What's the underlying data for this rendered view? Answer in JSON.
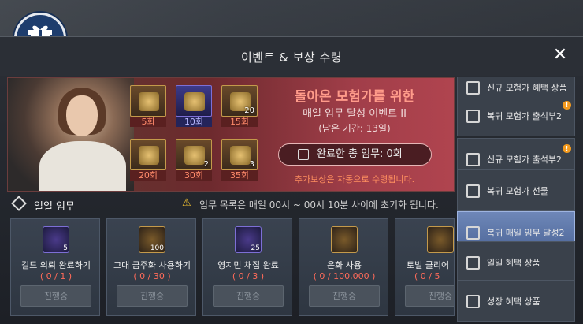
{
  "header": {
    "title": "이벤트 & 보상 수령",
    "close_glyph": "✕"
  },
  "banner": {
    "title": "돌아온 모험가를 위한",
    "subtitle": "매일 임무 달성 이벤트 II",
    "period": "(남은 기간: 13일)",
    "progress_text": "완료한 총 임무: 0회",
    "note": "추가보상은 자동으로 수령됩니다.",
    "rewards": [
      {
        "label": "5회",
        "count": "",
        "tier": "gold"
      },
      {
        "label": "10회",
        "count": "",
        "tier": "blue"
      },
      {
        "label": "15회",
        "count": "20",
        "tier": "gold"
      },
      {
        "label": "20회",
        "count": "",
        "tier": "gold"
      },
      {
        "label": "30회",
        "count": "2",
        "tier": "gold"
      },
      {
        "label": "35회",
        "count": "3",
        "tier": "gold"
      }
    ]
  },
  "daily": {
    "title": "일일 임무",
    "notice": "임무 목록은 매일 00시 ~ 00시 10분 사이에 초기화 됩니다.",
    "missions": [
      {
        "name": "길드 의뢰 완료하기",
        "progress": "( 0 / 1 )",
        "count": "5",
        "button": "진행중",
        "tier": "blue"
      },
      {
        "name": "고대 금주화 사용하기",
        "progress": "( 0 / 30 )",
        "count": "100",
        "button": "진행중",
        "tier": "gold"
      },
      {
        "name": "영지민 채집 완료",
        "progress": "( 0 / 3 )",
        "count": "25",
        "button": "진행중",
        "tier": "blue"
      },
      {
        "name": "은화 사용",
        "progress": "( 0 / 100,000 )",
        "count": "",
        "button": "진행중",
        "tier": "gold"
      },
      {
        "name": "토벌 클리어",
        "progress": "( 0 / 5",
        "count": "",
        "button": "진행중",
        "tier": "gold"
      }
    ]
  },
  "sidebar": {
    "items": [
      {
        "label": "신규 모험가 혜택 상품",
        "badge": ""
      },
      {
        "label": "복귀 모험가 출석부2",
        "badge": "!"
      },
      {
        "label": "신규 모험가 출석부2",
        "badge": "!"
      },
      {
        "label": "복귀 모험가 선물",
        "badge": ""
      },
      {
        "label": "복귀 매일 임무 달성2",
        "badge": "",
        "active": true
      },
      {
        "label": "일일 혜택 상품",
        "badge": ""
      },
      {
        "label": "성장 혜택 상품",
        "badge": ""
      }
    ]
  },
  "colors": {
    "accent_red": "#ff9b8a",
    "progress_red": "#ff6b5a",
    "notice_orange": "#ff8f5f",
    "active_blue": "#6e87b8",
    "badge_orange": "#f39a1e"
  },
  "icons": {
    "badge": "gift-icon",
    "close": "close-icon",
    "warning": "warning-icon",
    "daily": "diamond-icon"
  }
}
